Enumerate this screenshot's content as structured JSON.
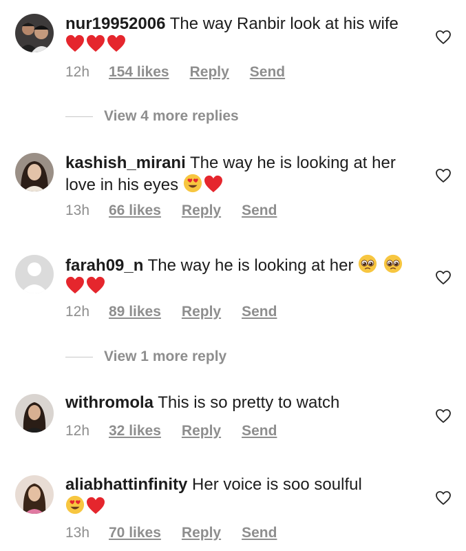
{
  "comments": [
    {
      "username": "nur19952006",
      "text": "The way Ranbir look at his wife",
      "time": "12h",
      "likes": "154 likes",
      "reply": "Reply",
      "send": "Send",
      "emojis": [
        "heart",
        "heart",
        "heart"
      ],
      "view_replies": "View 4 more replies"
    },
    {
      "username": "kashish_mirani",
      "text": "The way he is looking at her love in his eyes",
      "time": "13h",
      "likes": "66 likes",
      "reply": "Reply",
      "send": "Send",
      "emojis": [
        "heart-eyes",
        "heart"
      ]
    },
    {
      "username": "farah09_n",
      "text": "The way he is looking at her",
      "time": "12h",
      "likes": "89 likes",
      "reply": "Reply",
      "send": "Send",
      "emojis": [
        "pleading-face",
        "pleading-face",
        "heart",
        "heart"
      ],
      "view_replies": "View 1 more reply"
    },
    {
      "username": "withromola",
      "text": "This is so pretty to watch",
      "time": "12h",
      "likes": "32 likes",
      "reply": "Reply",
      "send": "Send",
      "emojis": []
    },
    {
      "username": "aliabhattinfinity",
      "text": "Her voice is soo soulful",
      "time": "13h",
      "likes": "70 likes",
      "reply": "Reply",
      "send": "Send",
      "emojis": [
        "heart-eyes",
        "heart"
      ]
    }
  ],
  "colors": {
    "heart": "#e5262d",
    "meta_text": "#8e8e8e",
    "emoji_face": "#f7c640"
  }
}
